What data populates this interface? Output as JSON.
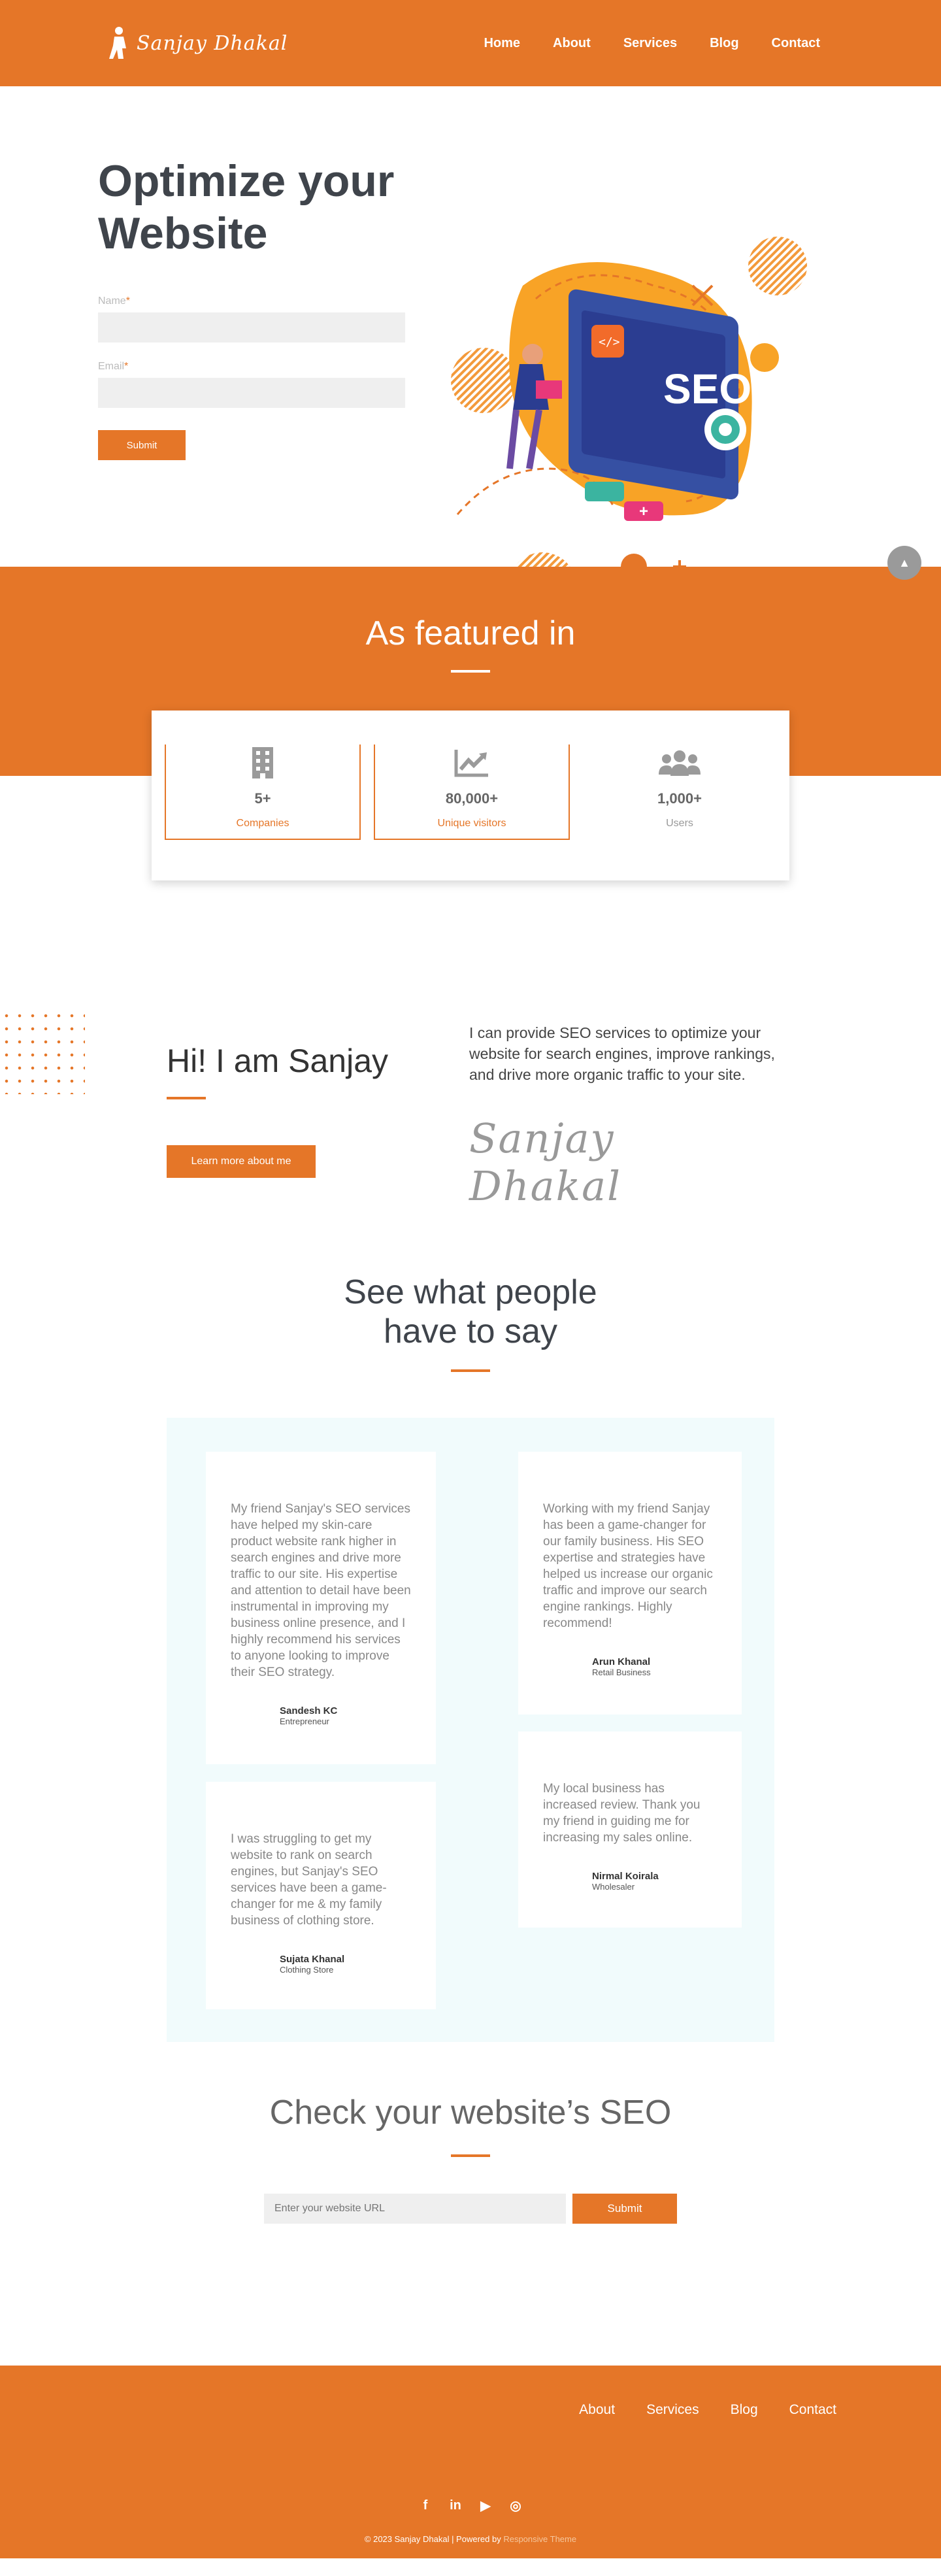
{
  "header": {
    "logo_text": "Sanjay Dhakal",
    "nav": [
      "Home",
      "About",
      "Services",
      "Blog",
      "Contact"
    ]
  },
  "hero": {
    "title": "Optimize your Website",
    "name_label": "Name",
    "email_label": "Email",
    "required_mark": "*",
    "submit_label": "Submit",
    "art_text": "SEO",
    "code_glyph": "</>"
  },
  "featured": {
    "title": "As featured in",
    "stats": [
      {
        "value": "5+",
        "label": "Companies",
        "icon": "building-icon"
      },
      {
        "value": "80,000+",
        "label": "Unique visitors",
        "icon": "chart-icon"
      },
      {
        "value": "1,000+",
        "label": "Users",
        "icon": "users-icon"
      }
    ]
  },
  "about": {
    "title": "Hi! I am Sanjay",
    "button_label": "Learn more about me",
    "text": "I can provide SEO services to optimize your website for search engines, improve rankings, and drive more organic traffic to your site.",
    "signature": "Sanjay Dhakal"
  },
  "testimonials": {
    "title_line1": "See what people",
    "title_line2": "have to say",
    "items": [
      {
        "text": "My friend Sanjay's SEO services have helped my skin-care product website rank higher in search engines and drive more traffic to our site. His expertise and attention to detail have been instrumental in improving my business online presence, and I highly recommend his services to anyone looking to improve their SEO strategy.",
        "name": "Sandesh KC",
        "role": "Entrepreneur"
      },
      {
        "text": "Working with my friend Sanjay has been a game-changer for our family business. His SEO expertise and strategies have helped us increase our organic traffic and improve our search engine rankings. Highly recommend!",
        "name": "Arun Khanal",
        "role": "Retail Business"
      },
      {
        "text": "I was struggling to get my website to rank on search engines, but Sanjay's SEO services have been a game-changer for me & my family business of clothing store.",
        "name": "Sujata Khanal",
        "role": "Clothing Store"
      },
      {
        "text": "My local business has increased review. Thank you my friend in guiding me for increasing my sales online.",
        "name": "Nirmal Koirala",
        "role": "Wholesaler"
      }
    ]
  },
  "seo_check": {
    "title": "Check your website’s SEO",
    "placeholder": "Enter your website URL",
    "button_label": "Submit"
  },
  "footer": {
    "nav": [
      "About",
      "Services",
      "Blog",
      "Contact"
    ],
    "socials": [
      "facebook-icon",
      "linkedin-icon",
      "youtube-icon",
      "instagram-icon"
    ],
    "social_glyphs": [
      "f",
      "in",
      "▶",
      "◎"
    ],
    "copyright": "© 2023 Sanjay Dhakal | Powered by ",
    "powered_by": "Responsive Theme"
  },
  "colors": {
    "accent": "#E57628",
    "title_gray": "#3F444B",
    "testimonial_bg": "#F1FBFC"
  }
}
